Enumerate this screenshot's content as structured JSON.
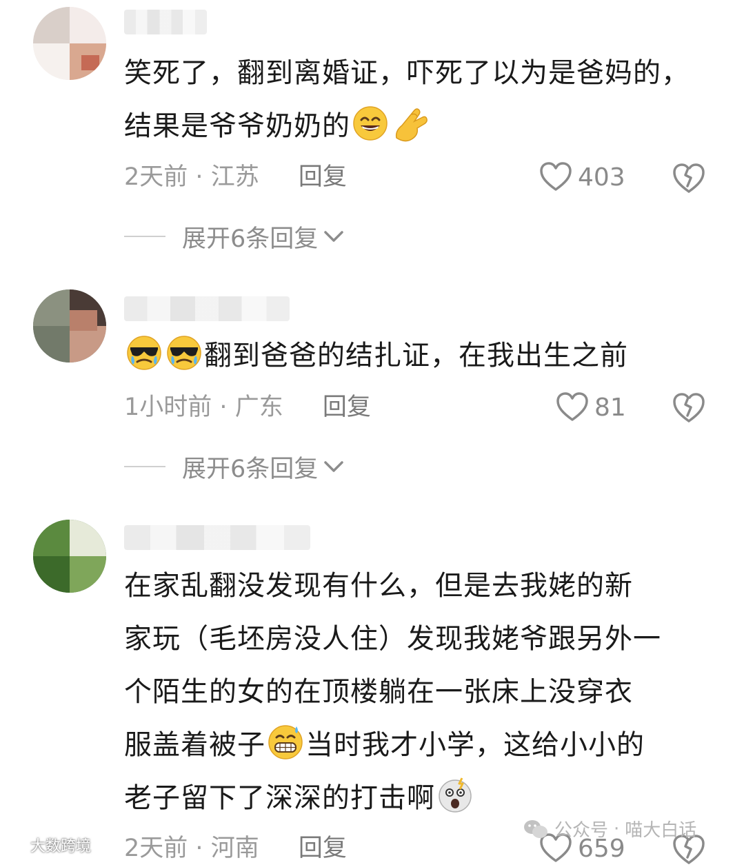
{
  "comments": [
    {
      "text_lines": [
        "笑死了，翻到离婚证，吓死了以为是爸妈的，",
        "结果是爷爷奶奶的"
      ],
      "emojis": [
        "grinning-sweat-face-icon",
        "pinched-fingers-hand-icon"
      ],
      "time": "2天前",
      "location": "江苏",
      "reply_label": "回复",
      "likes": "403",
      "expand_label": "展开6条回复"
    },
    {
      "text": "翻到爸爸的结扎证，在我出生之前",
      "emojis": [
        "sunglasses-tears-face-icon",
        "sunglasses-tears-face-icon"
      ],
      "time": "1小时前",
      "location": "广东",
      "reply_label": "回复",
      "likes": "81",
      "expand_label": "展开6条回复"
    },
    {
      "text_lines": [
        "在家乱翻没发现有什么，但是去我姥的新",
        "家玩（毛坯房没人住）发现我姥爷跟另外一",
        "个陌生的女的在顶楼躺在一张床上没穿衣",
        "服盖着被子",
        "当时我才小学，这给小小的",
        "老子留下了深深的打击啊"
      ],
      "emojis": [
        "grimacing-sweat-face-icon",
        "shocked-face-icon"
      ],
      "time": "2天前",
      "location": "河南",
      "reply_label": "回复",
      "likes": "659"
    }
  ],
  "separator": "·",
  "watermarks": {
    "left": "大数跨境",
    "right_prefix": "公众号",
    "right_name": "喵大白话"
  }
}
